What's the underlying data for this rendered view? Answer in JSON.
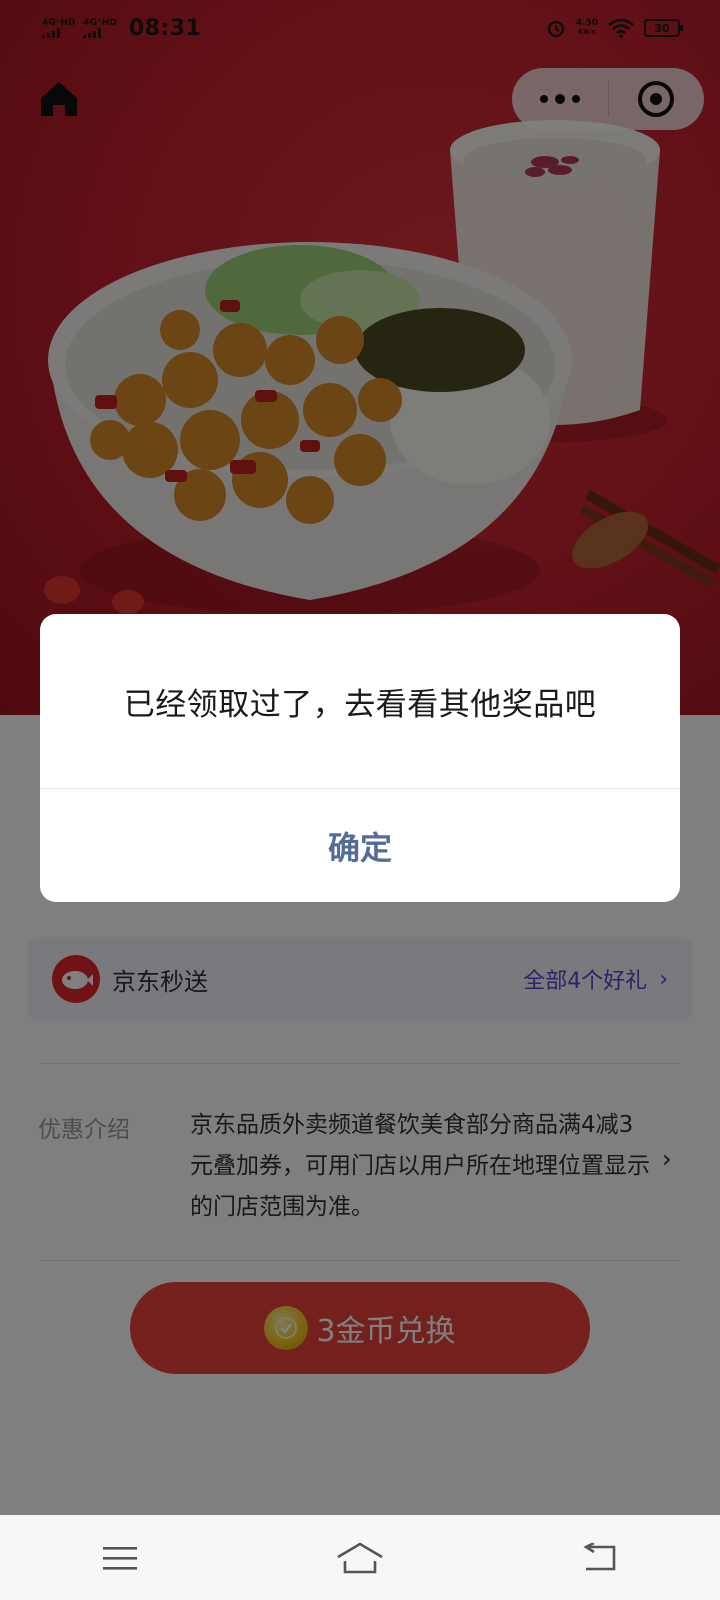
{
  "status_bar": {
    "network_1": "4G⁺HD",
    "network_2": "4G⁺HD",
    "time": "08:31",
    "speed_value": "4.50",
    "speed_unit": "KB/s",
    "battery": "30"
  },
  "top_nav": {
    "home_icon": "home-icon",
    "more_icon": "more-dots-icon",
    "close_icon": "target-circle-icon"
  },
  "hero": {
    "image": "food-bowl-and-milk-photo"
  },
  "content": {
    "shop": {
      "name": "京东秒送",
      "link_label": "全部4个好礼",
      "link_chevron": "›"
    },
    "intro": {
      "label": "优惠介绍",
      "text": "京东品质外卖频道餐饮美食部分商品满4减3元叠加券，可用门店以用户所在地理位置显示的门店范围为准。",
      "chevron": "›"
    },
    "redeem_button": {
      "label": "3金币兑换"
    }
  },
  "dialog": {
    "message": "已经领取过了，去看看其他奖品吧",
    "confirm_label": "确定"
  },
  "nav_bar": {
    "menu_icon": "menu-icon",
    "home_icon": "home-outline-icon",
    "back_icon": "back-icon"
  },
  "colors": {
    "brand_red": "#e8413b",
    "dialog_button": "#566c96",
    "link_purple": "#5b49c7"
  }
}
